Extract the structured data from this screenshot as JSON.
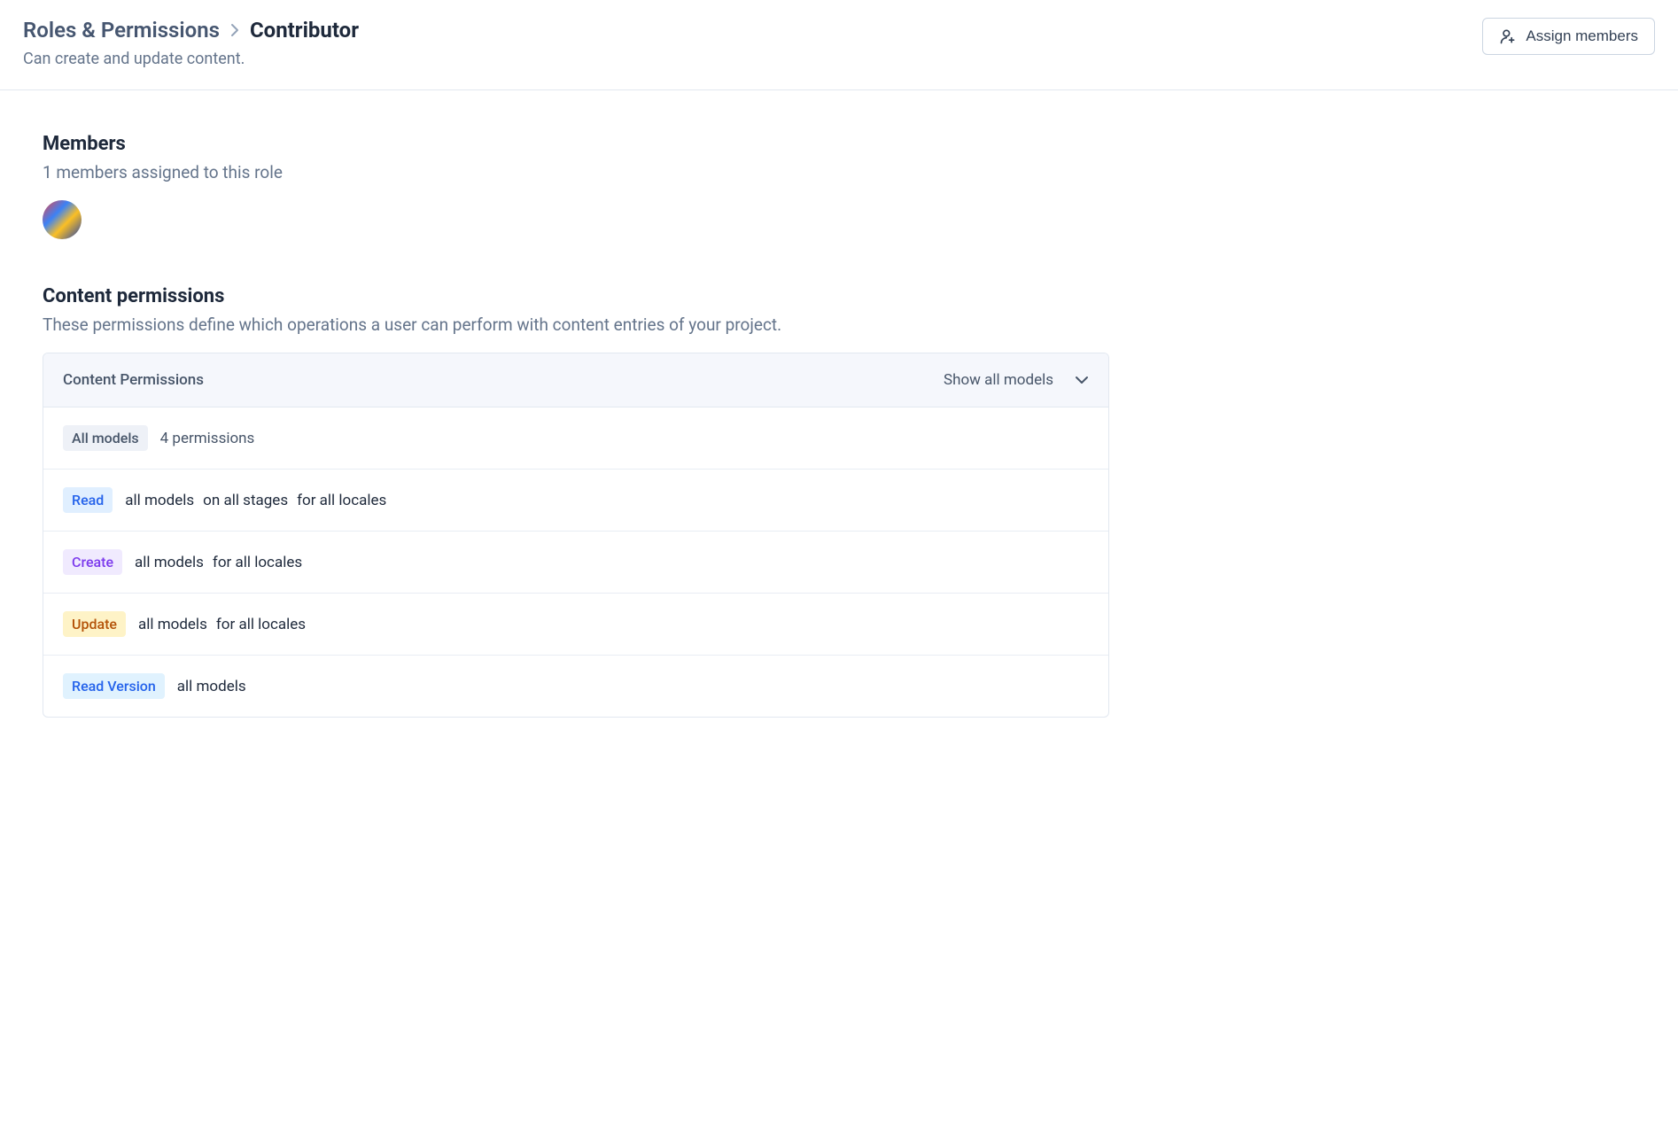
{
  "breadcrumb": {
    "parent": "Roles & Permissions",
    "current": "Contributor"
  },
  "subtitle": "Can create and update content.",
  "assign_button_label": "Assign members",
  "members": {
    "title": "Members",
    "subtitle": "1 members assigned to this role"
  },
  "content_permissions": {
    "title": "Content permissions",
    "subtitle": "These permissions define which operations a user can perform with content entries of your project.",
    "card_header": "Content Permissions",
    "show_all_label": "Show all models",
    "summary": {
      "tag": "All models",
      "count_text": "4 permissions"
    },
    "rows": [
      {
        "action": "Read",
        "tag_class": "tag-blue",
        "details": [
          "all models",
          "on all stages",
          "for all locales"
        ]
      },
      {
        "action": "Create",
        "tag_class": "tag-purple",
        "details": [
          "all models",
          "for all locales"
        ]
      },
      {
        "action": "Update",
        "tag_class": "tag-amber",
        "details": [
          "all models",
          "for all locales"
        ]
      },
      {
        "action": "Read Version",
        "tag_class": "tag-lightblue",
        "details": [
          "all models"
        ]
      }
    ]
  }
}
